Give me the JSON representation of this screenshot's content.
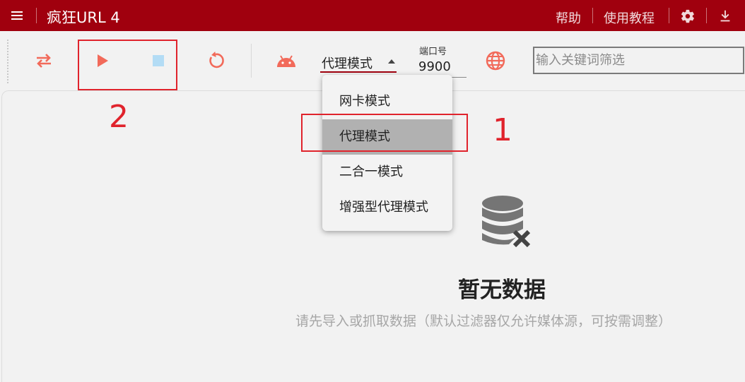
{
  "titlebar": {
    "app_title": "疯狂URL 4",
    "help_label": "帮助",
    "tutorial_label": "使用教程",
    "icons": [
      "menu-icon",
      "gear-icon",
      "download-icon"
    ]
  },
  "toolbar": {
    "icons": [
      "swap-arrows-icon",
      "play-icon",
      "stop-icon",
      "refresh-icon",
      "android-icon",
      "globe-icon"
    ],
    "mode_value": "代理模式",
    "port_label": "端口号",
    "port_value": "9900",
    "search_placeholder": "输入关键词筛选"
  },
  "mode_menu": {
    "items": [
      "网卡模式",
      "代理模式",
      "二合一模式",
      "增强型代理模式"
    ],
    "selected": "代理模式"
  },
  "empty_state": {
    "icon": "database-x-icon",
    "title": "暂无数据",
    "subtitle": "请先导入或抓取数据（默认过滤器仅允许媒体源，可按需调整）"
  },
  "annotations": {
    "label_1": "1",
    "label_2": "2"
  },
  "colors": {
    "titlebar": "#a0000e",
    "accent_icon": "#f26a5a",
    "stop_icon": "#b3dcf5",
    "annotation": "#e0232c",
    "selected_menu_item": "#b1b1b1"
  }
}
